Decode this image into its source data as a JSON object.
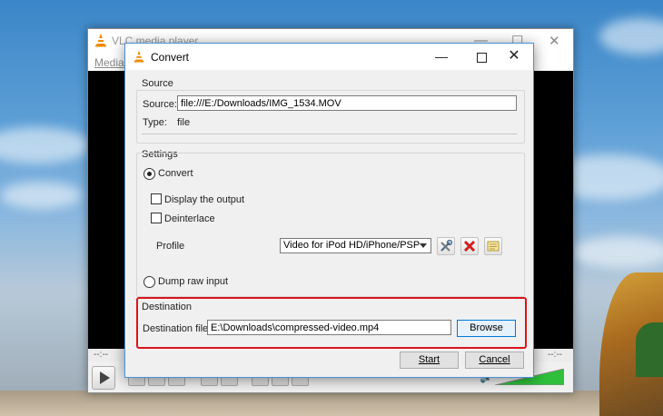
{
  "vlc_window": {
    "title": "VLC media player",
    "menu_media": "Media",
    "time_elapsed": "--:--",
    "time_total": "--:--",
    "volume_level": 1.0
  },
  "dialog": {
    "title": "Convert",
    "source": {
      "group_label": "Source",
      "source_label": "Source:",
      "source_value": "file:///E:/Downloads/IMG_1534.MOV",
      "type_label": "Type:",
      "type_value": "file"
    },
    "settings": {
      "group_label": "Settings",
      "convert_label": "Convert",
      "convert_selected": true,
      "display_output_label": "Display the output",
      "display_output_checked": false,
      "deinterlace_label": "Deinterlace",
      "deinterlace_checked": false,
      "profile_label": "Profile",
      "profile_value": "Video for iPod HD/iPhone/PSP",
      "dump_raw_label": "Dump raw input",
      "dump_raw_selected": false
    },
    "destination": {
      "group_label": "Destination",
      "file_label": "Destination file:",
      "file_value": "E:\\Downloads\\compressed-video.mp4",
      "browse_label": "Browse"
    },
    "start_label": "Start",
    "cancel_label": "Cancel"
  },
  "colors": {
    "highlight": "#d9141b",
    "vlc_orange": "#f08a00",
    "accent_blue": "#0078d7",
    "volume_green": "#2fbf3a"
  },
  "icons": [
    "vlc-cone-icon",
    "minimize-icon",
    "maximize-icon",
    "close-icon",
    "play-icon",
    "edit-profile-icon",
    "delete-profile-icon",
    "new-profile-icon",
    "volume-icon"
  ]
}
